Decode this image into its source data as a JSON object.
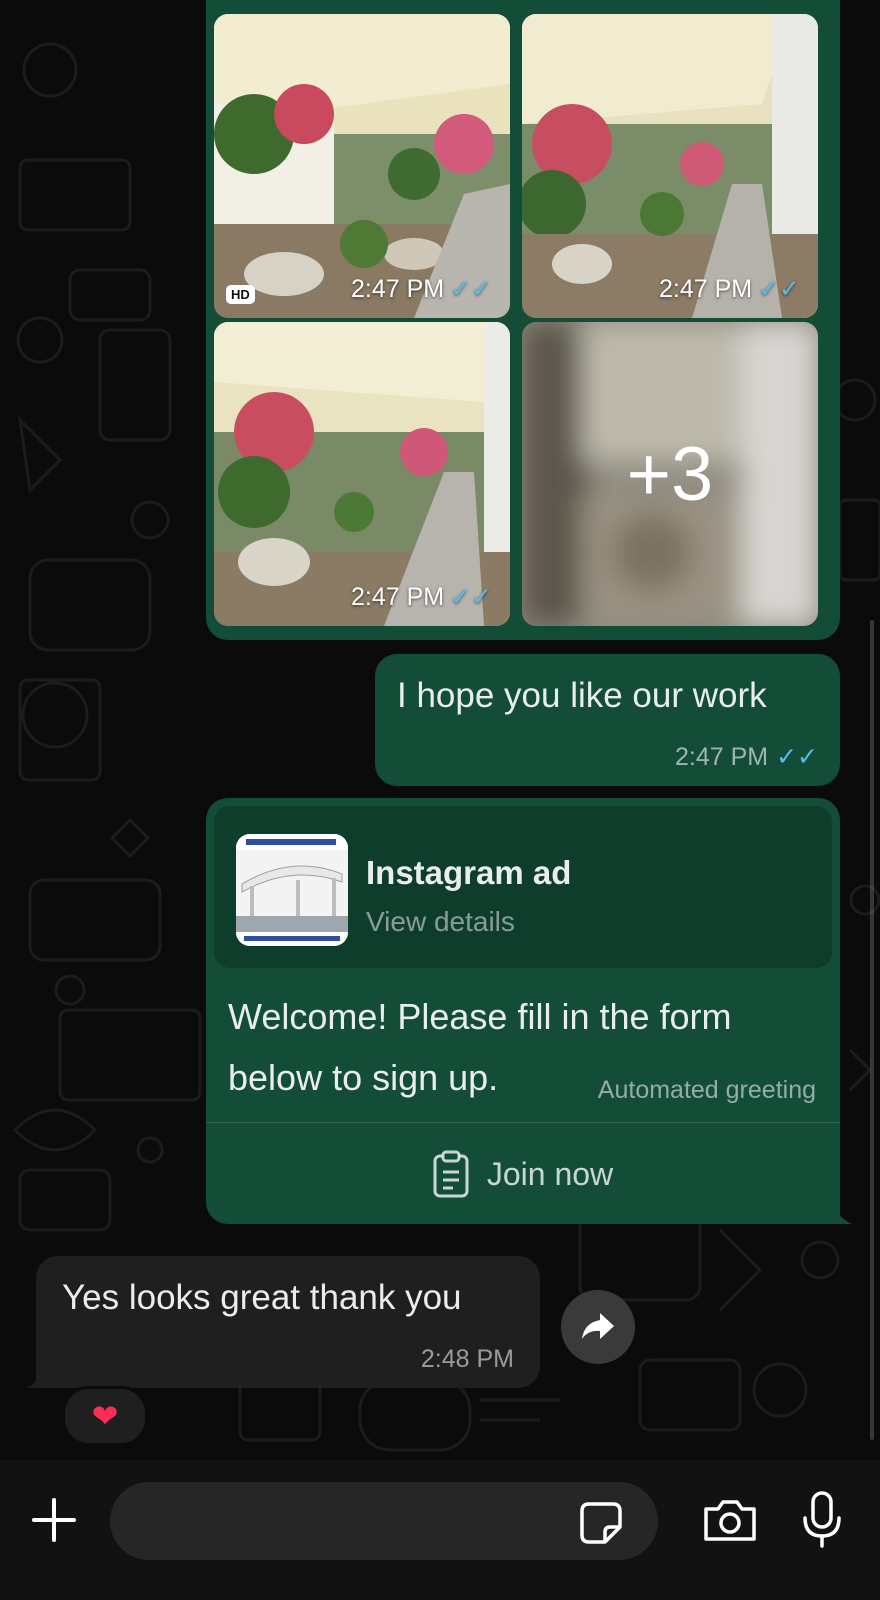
{
  "media_group": {
    "items": [
      {
        "time": "2:47 PM",
        "ticks": "✓✓",
        "hd_badge": "HD"
      },
      {
        "time": "2:47 PM",
        "ticks": "✓✓"
      },
      {
        "time": "2:47 PM",
        "ticks": "✓✓"
      },
      {
        "more_count": "+3"
      }
    ]
  },
  "messages": {
    "outgoing_text": {
      "text": "I hope you like our work",
      "time": "2:47 PM",
      "ticks": "✓✓"
    },
    "automated": {
      "ad_title": "Instagram ad",
      "ad_subtitle": "View details",
      "body_line1": "Welcome! Please fill in the form",
      "body_line2": "below to sign up.",
      "tag": "Automated greeting",
      "join_label": "Join now"
    },
    "incoming_text": {
      "text": "Yes looks great thank you",
      "time": "2:48 PM",
      "reaction": "❤"
    }
  },
  "input_bar": {
    "placeholder": "",
    "icons": [
      "plus-icon",
      "sticker-icon",
      "camera-icon",
      "microphone-icon"
    ]
  },
  "colors": {
    "outgoing_bubble": "#134d37",
    "incoming_bubble": "#1f1f1f",
    "read_ticks": "#53bdeb",
    "background": "#0b0b0b"
  }
}
